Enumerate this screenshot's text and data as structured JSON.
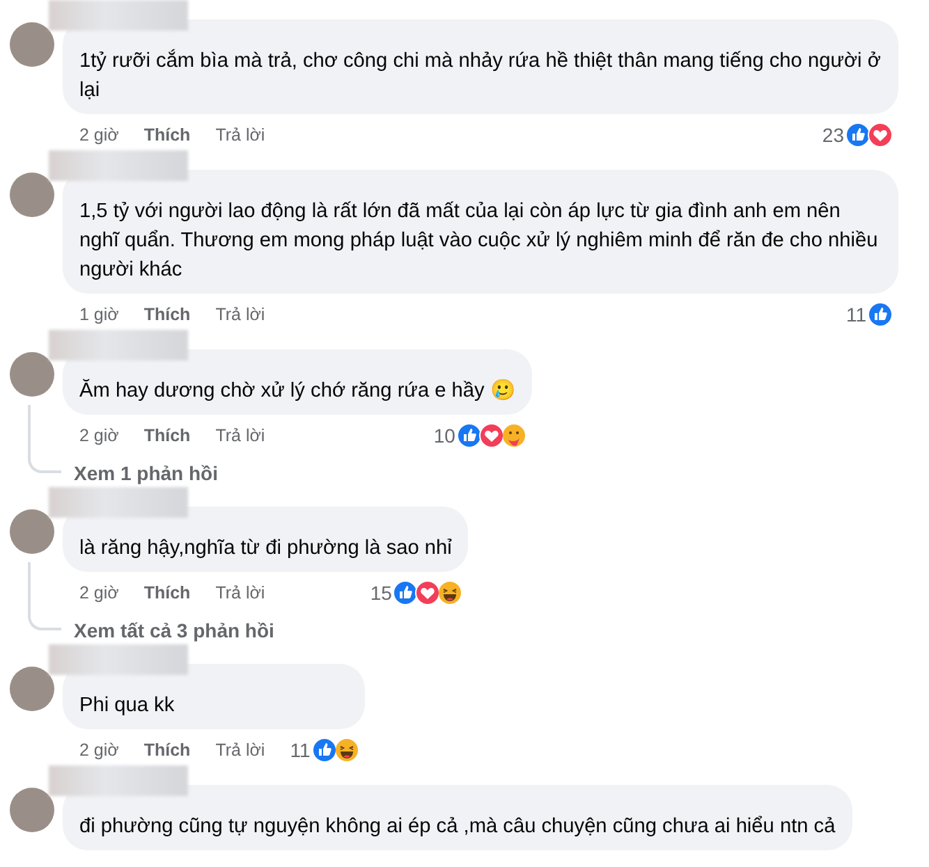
{
  "comments": [
    {
      "text": "1tỷ rưỡi cắm bìa mà trả, chơ công chi mà nhảy rứa hề thiệt thân mang tiếng cho người ở lại",
      "time": "2 giờ",
      "like_label": "Thích",
      "reply_label": "Trả lời",
      "reaction_count": "23",
      "reactions": [
        {
          "kind": "like"
        },
        {
          "kind": "love"
        }
      ]
    },
    {
      "text": "1,5 tỷ với người lao động là rất lớn đã mất của lại còn áp lực từ gia đình anh em nên nghĩ quẩn. Thương em mong pháp luật vào cuộc xử lý nghiêm minh để răn đe cho nhiều người khác",
      "time": "1 giờ",
      "like_label": "Thích",
      "reply_label": "Trả lời",
      "reaction_count": "11",
      "reactions": [
        {
          "kind": "like"
        }
      ]
    },
    {
      "text": "Ăm hay dương chờ xử lý chớ răng rứa e hầy 🥲",
      "time": "2 giờ",
      "like_label": "Thích",
      "reply_label": "Trả lời",
      "reaction_count": "10",
      "reactions": [
        {
          "kind": "like"
        },
        {
          "kind": "love"
        },
        {
          "kind": "care"
        }
      ],
      "replies_link": "Xem 1 phản hồi"
    },
    {
      "text": "là răng hậy,nghĩa từ đi phường là sao nhỉ",
      "time": "2 giờ",
      "like_label": "Thích",
      "reply_label": "Trả lời",
      "reaction_count": "15",
      "reactions": [
        {
          "kind": "like"
        },
        {
          "kind": "love"
        },
        {
          "kind": "haha"
        }
      ],
      "replies_link": "Xem tất cả 3 phản hồi"
    },
    {
      "text": "Phi qua kk",
      "time": "2 giờ",
      "like_label": "Thích",
      "reply_label": "Trả lời",
      "reaction_count": "11",
      "reactions": [
        {
          "kind": "like"
        },
        {
          "kind": "haha"
        }
      ]
    },
    {
      "text": "đi phường cũng tự nguyện không ai ép cả ,mà câu chuyện cũng chưa ai hiểu ntn cả"
    }
  ]
}
